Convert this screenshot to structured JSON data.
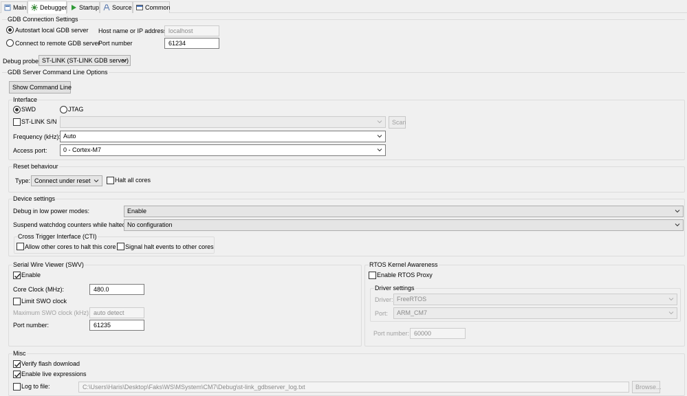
{
  "tabs": [
    {
      "label": "Main",
      "icon": "main-tab-icon"
    },
    {
      "label": "Debugger",
      "icon": "debugger-icon"
    },
    {
      "label": "Startup",
      "icon": "play-icon"
    },
    {
      "label": "Source",
      "icon": "source-icon"
    },
    {
      "label": "Common",
      "icon": "common-icon"
    }
  ],
  "active_tab": "Debugger",
  "gdb_connection": {
    "title": "GDB Connection Settings",
    "autostart_label": "Autostart local GDB server",
    "remote_label": "Connect to remote GDB server",
    "host_label": "Host name or IP address",
    "host_value": "localhost",
    "port_label": "Port number",
    "port_value": "61234"
  },
  "debug_probe": {
    "label": "Debug probe",
    "value": "ST-LINK (ST-LINK GDB server)"
  },
  "server_options": {
    "title": "GDB Server Command Line Options",
    "show_command_line": "Show Command Line"
  },
  "interface": {
    "title": "Interface",
    "swd_label": "SWD",
    "jtag_label": "JTAG",
    "stlink_sn_label": "ST-LINK S/N",
    "stlink_sn_value": "",
    "scan_label": "Scan",
    "frequency_label": "Frequency (kHz):",
    "frequency_value": "Auto",
    "access_port_label": "Access port:",
    "access_port_value": "0 - Cortex-M7"
  },
  "reset": {
    "title": "Reset behaviour",
    "type_label": "Type:",
    "type_value": "Connect under reset",
    "halt_all_label": "Halt all cores"
  },
  "device": {
    "title": "Device settings",
    "low_power_label": "Debug in low power modes:",
    "low_power_value": "Enable",
    "watchdog_label": "Suspend watchdog counters while halted:",
    "watchdog_value": "No configuration",
    "cti_title": "Cross Trigger Interface (CTI)",
    "cti_allow_label": "Allow other cores to halt this core",
    "cti_signal_label": "Signal halt events to other cores"
  },
  "swv": {
    "title": "Serial Wire Viewer (SWV)",
    "enable_label": "Enable",
    "core_clock_label": "Core Clock (MHz):",
    "core_clock_value": "480.0",
    "limit_swo_label": "Limit SWO clock",
    "max_swo_label": "Maximum SWO clock (kHz):",
    "max_swo_value": "auto detect",
    "port_label": "Port number:",
    "port_value": "61235"
  },
  "rtos": {
    "title": "RTOS Kernel Awareness",
    "enable_proxy_label": "Enable RTOS Proxy",
    "driver_settings_title": "Driver settings",
    "driver_label": "Driver:",
    "driver_value": "FreeRTOS",
    "port_label": "Port:",
    "port_value": "ARM_CM7",
    "port_number_label": "Port number:",
    "port_number_value": "60000"
  },
  "misc": {
    "title": "Misc",
    "verify_flash_label": "Verify flash download",
    "live_expr_label": "Enable live expressions",
    "log_to_file_label": "Log to file:",
    "log_path": "C:\\Users\\Haris\\Desktop\\Faks\\WS\\MSystem\\CM7\\Debug\\st-link_gdbserver_log.txt",
    "browse_label": "Browse..."
  }
}
